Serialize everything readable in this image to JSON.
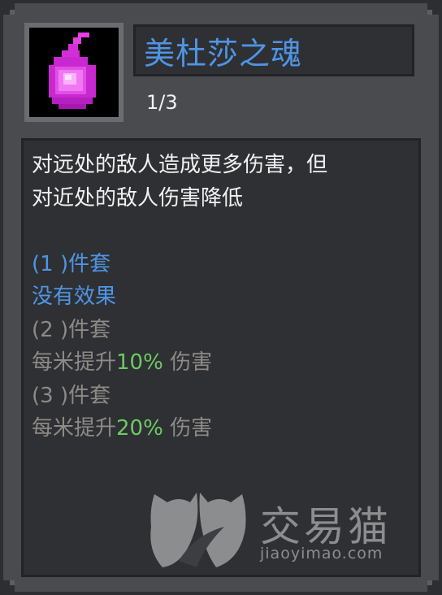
{
  "item": {
    "name": "美杜莎之魂",
    "count": "1/3",
    "icon": "soul-flame-icon",
    "color_accent": "#4f95e4"
  },
  "description": {
    "line1": "对远处的敌人造成更多伤害，但",
    "line2": "对近处的敌人伤害降低"
  },
  "set_bonuses": [
    {
      "header": "(1 )件套",
      "effect": "没有效果",
      "active": true
    },
    {
      "header": "(2 )件套",
      "effect_prefix": "每米提升",
      "effect_value": "10%",
      "effect_suffix": " 伤害",
      "active": false
    },
    {
      "header": "(3 )件套",
      "effect_prefix": "每米提升",
      "effect_value": "20%",
      "effect_suffix": " 伤害",
      "active": false
    }
  ],
  "watermark": {
    "name": "交易猫",
    "url": "jiaoyimao.com",
    "logo": "cat-logo-icon"
  },
  "colors": {
    "active": "#4f95e4",
    "inactive": "#8e8a86",
    "value_green": "#6fc964",
    "panel": "#494b4f",
    "box": "#2e3034"
  }
}
